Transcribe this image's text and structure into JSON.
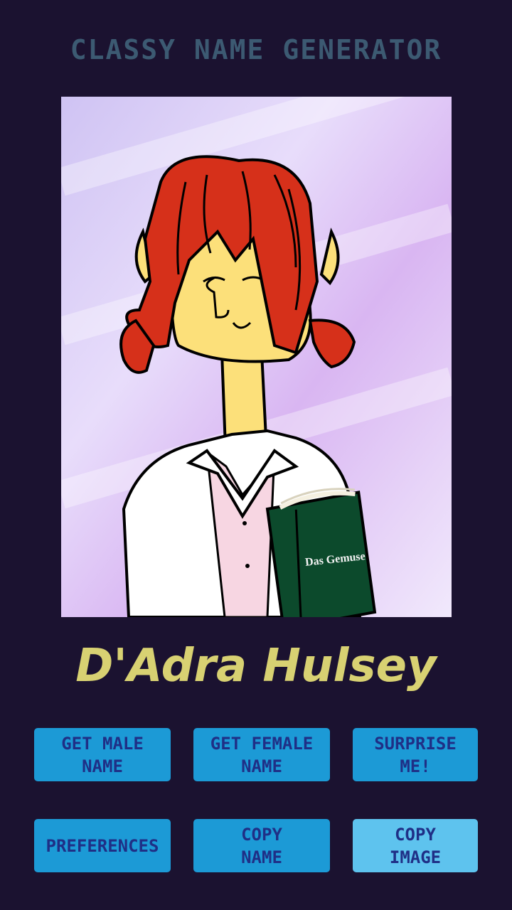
{
  "app": {
    "title": "CLASSY NAME GENERATOR"
  },
  "portrait": {
    "book_title": "Das Gemuse"
  },
  "generated_name": "D'Adra Hulsey",
  "buttons": {
    "male": "GET MALE\nNAME",
    "female": "GET FEMALE\nNAME",
    "surprise": "SURPRISE\nME!",
    "preferences": "PREFERENCES",
    "copy_name": "COPY\nNAME",
    "copy_image": "COPY\nIMAGE"
  },
  "colors": {
    "background": "#1b1230",
    "title": "#3c5a72",
    "name": "#d8d172",
    "button": "#1c9ad6",
    "button_disabled": "#5ec3ee",
    "button_text": "#1f2f86"
  }
}
